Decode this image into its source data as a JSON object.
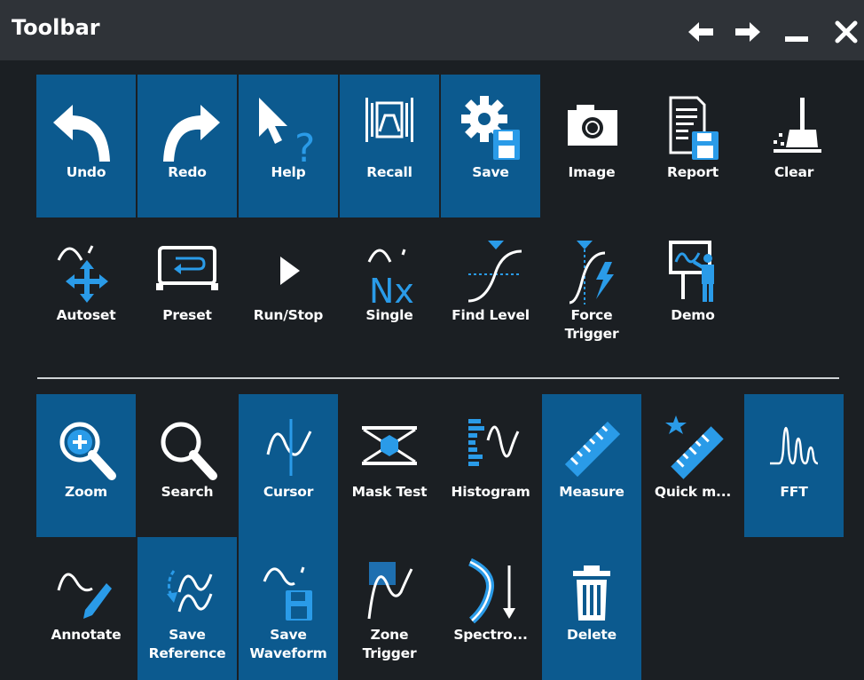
{
  "window": {
    "title": "Toolbar"
  },
  "titlebar_buttons": [
    {
      "icon": "arrow-left-icon"
    },
    {
      "icon": "arrow-right-icon"
    },
    {
      "icon": "minimize-icon"
    },
    {
      "icon": "close-icon"
    }
  ],
  "colors": {
    "active": "#0c5a8f",
    "accent": "#1e8fe1",
    "background": "#1b1f23",
    "titlebar": "#2f3338"
  },
  "toolbar": {
    "row1": [
      {
        "label": "Undo",
        "icon": "undo-icon",
        "active": true
      },
      {
        "label": "Redo",
        "icon": "redo-icon",
        "active": true
      },
      {
        "label": "Help",
        "icon": "help-icon",
        "active": true
      },
      {
        "label": "Recall",
        "icon": "recall-icon",
        "active": true
      },
      {
        "label": "Save",
        "icon": "save-settings-icon",
        "active": true
      },
      {
        "label": "Image",
        "icon": "camera-icon",
        "active": false
      },
      {
        "label": "Report",
        "icon": "report-icon",
        "active": false
      },
      {
        "label": "Clear",
        "icon": "broom-icon",
        "active": false
      }
    ],
    "row2": [
      {
        "label": "Autoset",
        "icon": "autoset-icon",
        "active": false
      },
      {
        "label": "Preset",
        "icon": "preset-icon",
        "active": false
      },
      {
        "label": "Run/Stop",
        "icon": "play-icon",
        "active": false
      },
      {
        "label": "Single",
        "icon": "single-icon",
        "active": false
      },
      {
        "label": "Find Level",
        "icon": "find-level-icon",
        "active": false
      },
      {
        "label": "Force\nTrigger",
        "icon": "force-trigger-icon",
        "active": false
      },
      {
        "label": "Demo",
        "icon": "demo-icon",
        "active": false
      }
    ],
    "row3": [
      {
        "label": "Zoom",
        "icon": "zoom-icon",
        "active": true
      },
      {
        "label": "Search",
        "icon": "search-icon",
        "active": false
      },
      {
        "label": "Cursor",
        "icon": "cursor-icon",
        "active": true
      },
      {
        "label": "Mask Test",
        "icon": "mask-test-icon",
        "active": false
      },
      {
        "label": "Histogram",
        "icon": "histogram-icon",
        "active": false
      },
      {
        "label": "Measure",
        "icon": "ruler-icon",
        "active": true
      },
      {
        "label": "Quick m...",
        "icon": "quick-measure-icon",
        "active": false
      },
      {
        "label": "FFT",
        "icon": "fft-icon",
        "active": true
      }
    ],
    "row4": [
      {
        "label": "Annotate",
        "icon": "annotate-icon",
        "active": false
      },
      {
        "label": "Save\nReference",
        "icon": "save-reference-icon",
        "active": true
      },
      {
        "label": "Save\nWaveform",
        "icon": "save-waveform-icon",
        "active": true
      },
      {
        "label": "Zone\nTrigger",
        "icon": "zone-trigger-icon",
        "active": false
      },
      {
        "label": "Spectro...",
        "icon": "spectrogram-icon",
        "active": false
      },
      {
        "label": "Delete",
        "icon": "trash-icon",
        "active": true
      }
    ]
  }
}
